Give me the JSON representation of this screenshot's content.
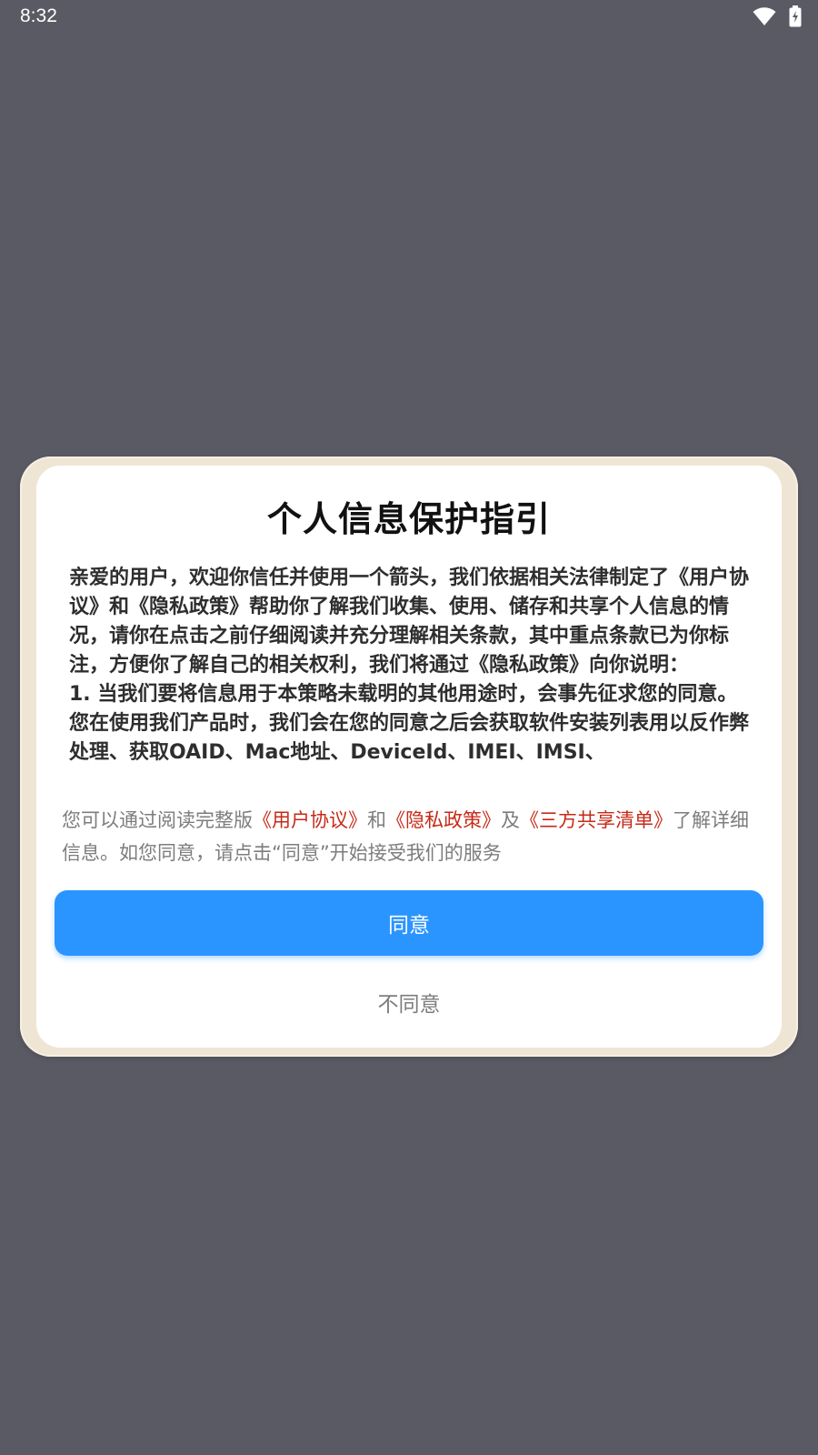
{
  "status_bar": {
    "time": "8:32",
    "icons": [
      "wifi-icon",
      "battery-charging-icon"
    ]
  },
  "dialog": {
    "title": "个人信息保护指引",
    "body_paragraphs": [
      "亲爱的用户，欢迎你信任并使用一个箭头，我们依据相关法律制定了《用户协议》和《隐私政策》帮助你了解我们收集、使用、储存和共享个人信息的情况，请你在点击之前仔细阅读并充分理解相关条款，其中重点条款已为你标注，方便你了解自己的相关权利，我们将通过《隐私政策》向你说明：",
      "1. 当我们要将信息用于本策略未载明的其他用途时，会事先征求您的同意。 您在使用我们产品时，我们会在您的同意之后会获取软件安装列表用以反作弊处理、获取OAID、Mac地址、DeviceId、IMEI、IMSI、"
    ],
    "summary": {
      "prefix": "您可以通过阅读完整版",
      "link_user_agreement": "《用户协议》",
      "and": "和",
      "link_privacy_policy": "《隐私政策》",
      "also": "及",
      "link_third_party_list": "《三方共享清单》",
      "suffix": "了解详细信息。如您同意，请点击“同意”开始接受我们的服务"
    },
    "agree_label": "同意",
    "disagree_label": "不同意"
  },
  "colors": {
    "backdrop": "#5a5a64",
    "frame": "#efe5d4",
    "primary": "#2b95ff",
    "link": "#c62a18",
    "muted_text": "#7d7d7d"
  }
}
